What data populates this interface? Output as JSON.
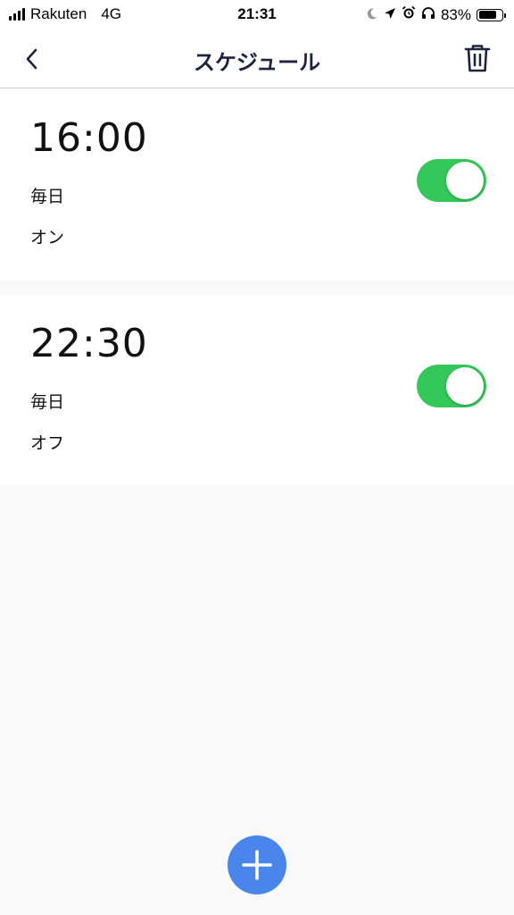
{
  "status_bar": {
    "carrier": "Rakuten",
    "network": "4G",
    "time": "21:31",
    "battery_percent_label": "83%",
    "battery_level": 0.83
  },
  "header": {
    "title": "スケジュール",
    "back_icon": "chevron-left-icon",
    "delete_icon": "trash-icon"
  },
  "schedules": [
    {
      "time": "16:00",
      "repeat": "毎日",
      "action": "オン",
      "enabled": true
    },
    {
      "time": "22:30",
      "repeat": "毎日",
      "action": "オフ",
      "enabled": true
    }
  ],
  "fab": {
    "icon": "plus-icon"
  },
  "colors": {
    "toggle_on": "#34c759",
    "fab": "#4a85ec",
    "title": "#1e2340",
    "background": "#f9f9f9"
  }
}
